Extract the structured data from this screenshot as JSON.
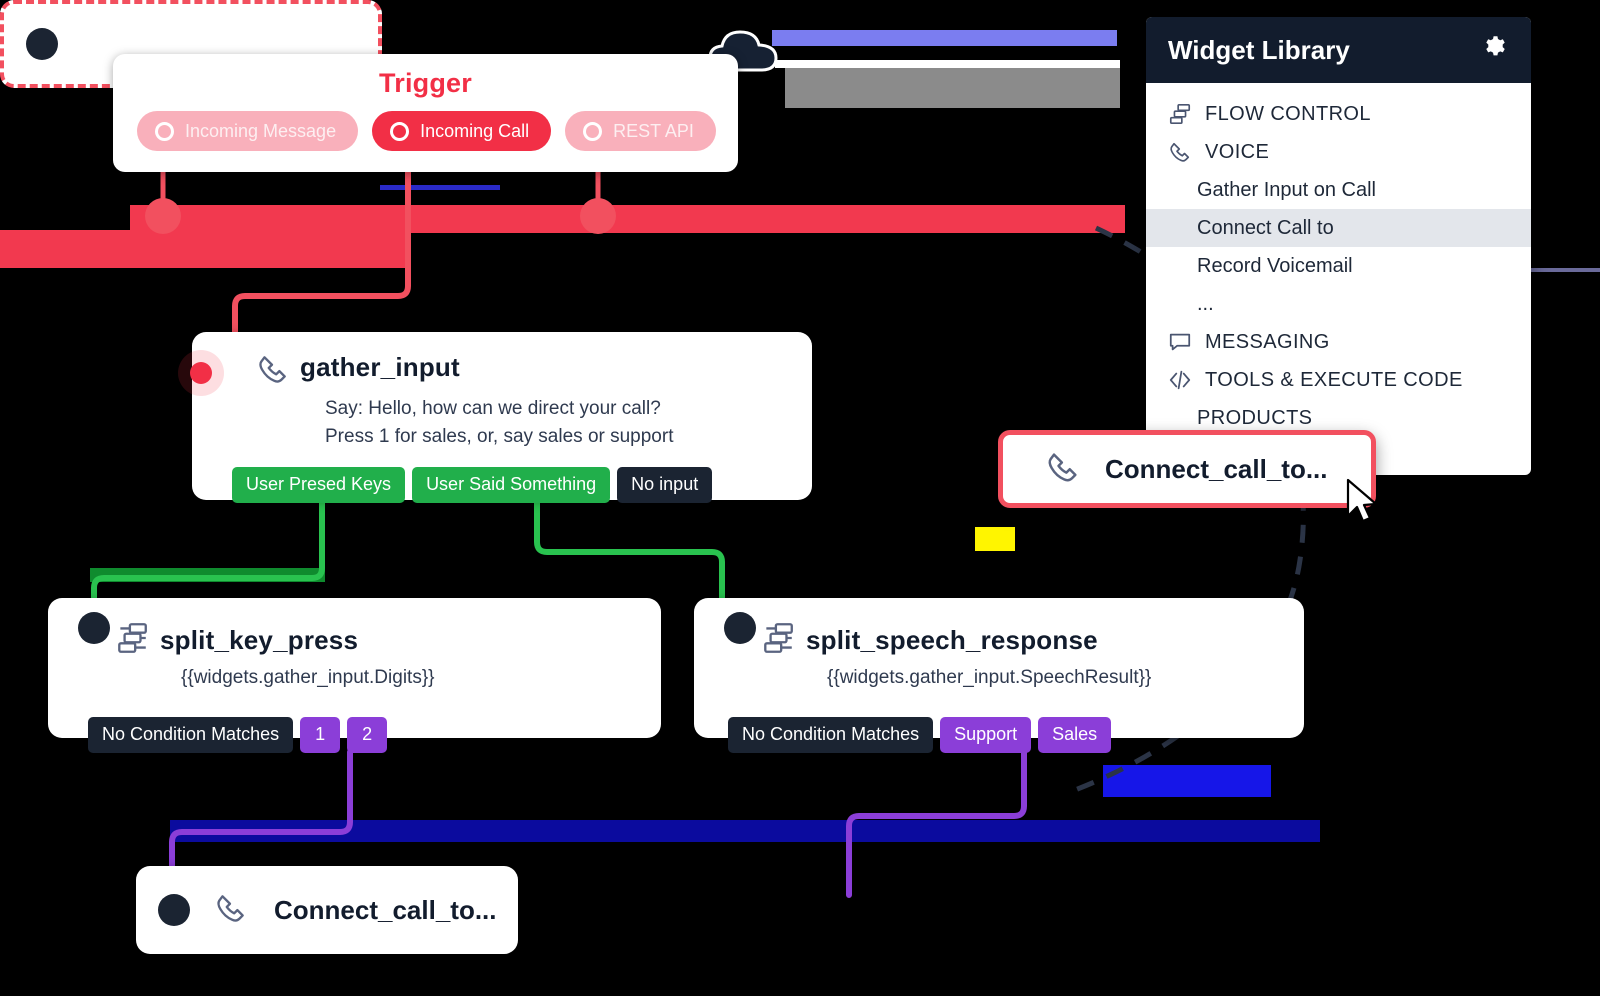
{
  "trigger": {
    "title": "Trigger",
    "pills": [
      {
        "label": "Incoming Message",
        "state": "inactive"
      },
      {
        "label": "Incoming Call",
        "state": "active"
      },
      {
        "label": "REST API",
        "state": "inactive"
      }
    ]
  },
  "gather_input": {
    "title": "gather_input",
    "icon": "phone-icon",
    "line1": "Say: Hello, how can we direct your call?",
    "line2": "Press 1 for sales, or, say sales or support",
    "transitions": [
      {
        "label": "User Presed Keys",
        "style": "green"
      },
      {
        "label": "User Said Something",
        "style": "green"
      },
      {
        "label": "No input",
        "style": "dark"
      }
    ]
  },
  "split_key_press": {
    "title": "split_key_press",
    "icon": "flow-control-icon",
    "expression": "{{widgets.gather_input.Digits}}",
    "transitions": [
      {
        "label": "No Condition Matches",
        "style": "dark"
      },
      {
        "label": "1",
        "style": "purple"
      },
      {
        "label": "2",
        "style": "purple"
      }
    ]
  },
  "split_speech_response": {
    "title": "split_speech_response",
    "icon": "flow-control-icon",
    "expression": "{{widgets.gather_input.SpeechResult}}",
    "transitions": [
      {
        "label": "No Condition Matches",
        "style": "dark"
      },
      {
        "label": "Support",
        "style": "purple"
      },
      {
        "label": "Sales",
        "style": "purple"
      }
    ]
  },
  "connect_left": {
    "title": "Connect_call_to...",
    "icon": "phone-icon"
  },
  "drop_target": {
    "title": "",
    "icon": ""
  },
  "drag_node": {
    "title": "Connect_call_to...",
    "icon": "phone-icon"
  },
  "widget_library": {
    "title": "Widget Library",
    "settings_icon": "gear-icon",
    "rows": [
      {
        "label": "FLOW CONTROL",
        "type": "cat",
        "icon": "flow-control-icon",
        "selected": false
      },
      {
        "label": "VOICE",
        "type": "cat",
        "icon": "phone-icon",
        "selected": false
      },
      {
        "label": "Gather Input on Call",
        "type": "item",
        "icon": "",
        "selected": false
      },
      {
        "label": "Connect Call to",
        "type": "item",
        "icon": "",
        "selected": true
      },
      {
        "label": "Record Voicemail",
        "type": "item",
        "icon": "",
        "selected": false
      },
      {
        "label": "...",
        "type": "item",
        "icon": "",
        "selected": false
      },
      {
        "label": "MESSAGING",
        "type": "cat",
        "icon": "chat-icon",
        "selected": false
      },
      {
        "label": "TOOLS & EXECUTE CODE",
        "type": "cat",
        "icon": "code-icon",
        "selected": false
      },
      {
        "label": "PRODUCTS",
        "type": "cat",
        "icon": "",
        "selected": false
      }
    ]
  },
  "colors": {
    "trigger_red": "#F22F46",
    "trigger_red_pale": "#F9B0BB",
    "green": "#21AF4B",
    "dark": "#1B2432",
    "purple": "#8B3ED8",
    "navy": "#121C2D",
    "selected_row": "#E3E6EB"
  }
}
